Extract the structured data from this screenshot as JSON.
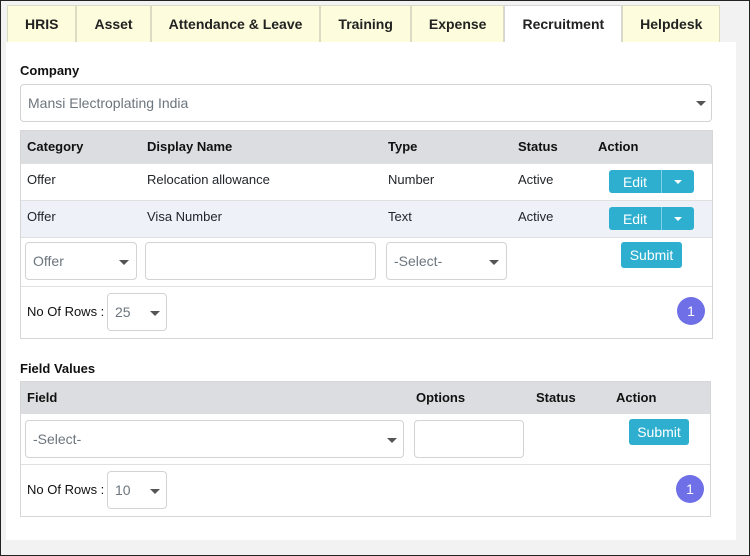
{
  "tabs": [
    {
      "label": "HRIS",
      "active": false
    },
    {
      "label": "Asset",
      "active": false
    },
    {
      "label": "Attendance & Leave",
      "active": false
    },
    {
      "label": "Training",
      "active": false
    },
    {
      "label": "Expense",
      "active": false
    },
    {
      "label": "Recruitment",
      "active": true
    },
    {
      "label": "Helpdesk",
      "active": false
    }
  ],
  "company": {
    "label": "Company",
    "selected": "Mansi Electroplating India"
  },
  "fields_table": {
    "headers": [
      "Category",
      "Display Name",
      "Type",
      "Status",
      "Action"
    ],
    "rows": [
      {
        "category": "Offer",
        "display_name": "Relocation allowance",
        "type": "Number",
        "status": "Active",
        "action": "Edit"
      },
      {
        "category": "Offer",
        "display_name": "Visa Number",
        "type": "Text",
        "status": "Active",
        "action": "Edit"
      }
    ],
    "new_row": {
      "category_selected": "Offer",
      "display_name_value": "",
      "type_selected": "-Select-",
      "submit_label": "Submit"
    },
    "rows_label": "No Of Rows :",
    "rows_selected": "25",
    "page": "1"
  },
  "field_values": {
    "label": "Field Values",
    "headers": [
      "Field",
      "Options",
      "Status",
      "Action"
    ],
    "new_row": {
      "field_selected": "-Select-",
      "options_value": "",
      "submit_label": "Submit"
    },
    "rows_label": "No Of Rows :",
    "rows_selected": "10",
    "page": "1"
  },
  "colors": {
    "accent": "#2eafd0",
    "page_badge": "#6f6fe8",
    "tab_bg": "#fdfcdc",
    "header_bg": "#dcdde0"
  }
}
